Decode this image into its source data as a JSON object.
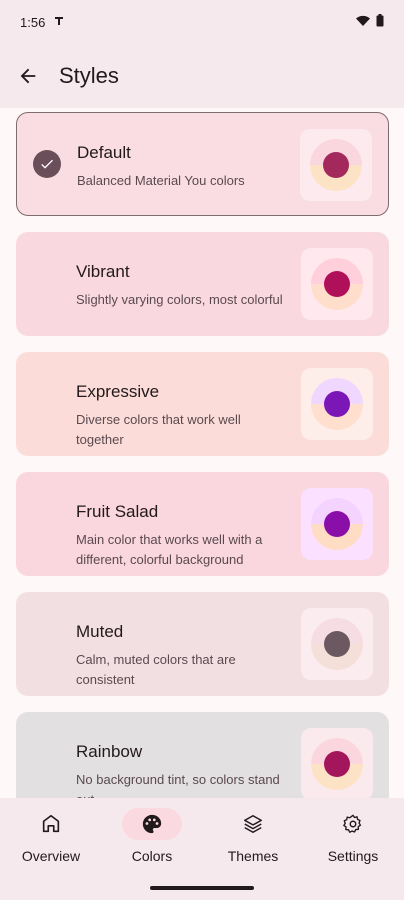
{
  "status": {
    "time": "1:56"
  },
  "header": {
    "title": "Styles"
  },
  "styles": [
    {
      "name": "Default",
      "desc": "Balanced Material You colors",
      "selected": true,
      "card_bg": "#fadde3",
      "preview_bg": "#fdeaee",
      "ring_top": "#fad6df",
      "ring_bottom": "#fde3c5",
      "dot": "#a3285c"
    },
    {
      "name": "Vibrant",
      "desc": "Slightly varying colors, most colorful",
      "selected": false,
      "card_bg": "#fad8e0",
      "preview_bg": "#ffe9ee",
      "ring_top": "#ffd0db",
      "ring_bottom": "#ffdfcb",
      "dot": "#b0105a"
    },
    {
      "name": "Expressive",
      "desc": "Diverse colors that work well together",
      "selected": false,
      "card_bg": "#fbdcd8",
      "preview_bg": "#fdeeea",
      "ring_top": "#efd7ff",
      "ring_bottom": "#ffdfcd",
      "dot": "#7a17b6"
    },
    {
      "name": "Fruit Salad",
      "desc": "Main color that works well with a different, colorful background",
      "selected": false,
      "card_bg": "#fad6de",
      "preview_bg": "#fbe1ff",
      "ring_top": "#f5d3ff",
      "ring_bottom": "#ffdcc4",
      "dot": "#8a0fa8"
    },
    {
      "name": "Muted",
      "desc": "Calm, muted colors that are consistent",
      "selected": false,
      "card_bg": "#f2dfe2",
      "preview_bg": "#fbecef",
      "ring_top": "#f6dde3",
      "ring_bottom": "#f5dfd9",
      "dot": "#6b5860"
    },
    {
      "name": "Rainbow",
      "desc": "No background tint, so colors stand out",
      "selected": false,
      "card_bg": "#e2e0e0",
      "preview_bg": "#fbeaed",
      "ring_top": "#fcd6df",
      "ring_bottom": "#fde3c6",
      "dot": "#a3165c"
    }
  ],
  "nav": [
    {
      "label": "Overview",
      "icon": "home-icon",
      "active": false
    },
    {
      "label": "Colors",
      "icon": "palette-icon",
      "active": true
    },
    {
      "label": "Themes",
      "icon": "layers-icon",
      "active": false
    },
    {
      "label": "Settings",
      "icon": "gear-icon",
      "active": false
    }
  ]
}
